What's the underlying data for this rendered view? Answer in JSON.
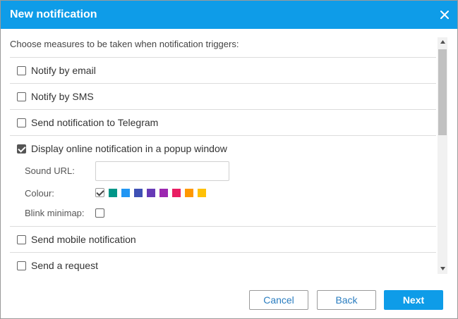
{
  "dialog": {
    "title": "New notification",
    "intro": "Choose measures to be taken when notification triggers:"
  },
  "actions": [
    {
      "label": "Notify by email",
      "checked": false
    },
    {
      "label": "Notify by SMS",
      "checked": false
    },
    {
      "label": "Send notification to Telegram",
      "checked": false
    },
    {
      "label": "Display online notification in a popup window",
      "checked": true
    },
    {
      "label": "Send mobile notification",
      "checked": false
    },
    {
      "label": "Send a request",
      "checked": false
    }
  ],
  "popup_options": {
    "sound_url_label": "Sound URL:",
    "sound_url_value": "",
    "colour_label": "Colour:",
    "colours": [
      "#ffffff",
      "#009688",
      "#2196f3",
      "#3f51b5",
      "#673ab7",
      "#9c27b0",
      "#e91e63",
      "#ff9800",
      "#ffc107"
    ],
    "selected_colour_index": 0,
    "blink_minimap_label": "Blink minimap:",
    "blink_minimap_checked": false
  },
  "buttons": {
    "cancel": "Cancel",
    "back": "Back",
    "next": "Next"
  },
  "colors": {
    "accent": "#0e9ce8",
    "link": "#2a7dc0",
    "border": "#dcdcdc"
  },
  "icons": {
    "close": "close-icon",
    "scroll_up": "chevron-up-icon",
    "scroll_down": "chevron-down-icon",
    "check": "checkmark-icon"
  }
}
